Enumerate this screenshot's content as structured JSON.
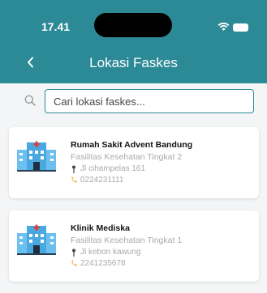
{
  "status_bar": {
    "time": "17.41"
  },
  "header": {
    "title": "Lokasi Faskes"
  },
  "search": {
    "placeholder": "Cari lokasi faskes..."
  },
  "facilities": [
    {
      "name": "Rumah Sakit Advent Bandung",
      "type": "Fasilitas Kesehatan Tingkat 2",
      "address": "Jl cihampelas 161",
      "phone": "0224231111"
    },
    {
      "name": "Klinik Mediska",
      "type": "Fasilitas Kesehatan Tingkat 1",
      "address": "Jl kebon kawung",
      "phone": "2241235678"
    }
  ],
  "colors": {
    "header": "#2c8a96",
    "accent": "#2c8a96",
    "list_background": "#f3f5f6",
    "phone_icon": "#f0c060",
    "hospital_icon": "#4aa8e0"
  },
  "icons": [
    "wifi-icon",
    "battery-icon",
    "back-arrow-icon",
    "search-icon",
    "hospital-icon",
    "location-pin-icon",
    "phone-icon"
  ]
}
